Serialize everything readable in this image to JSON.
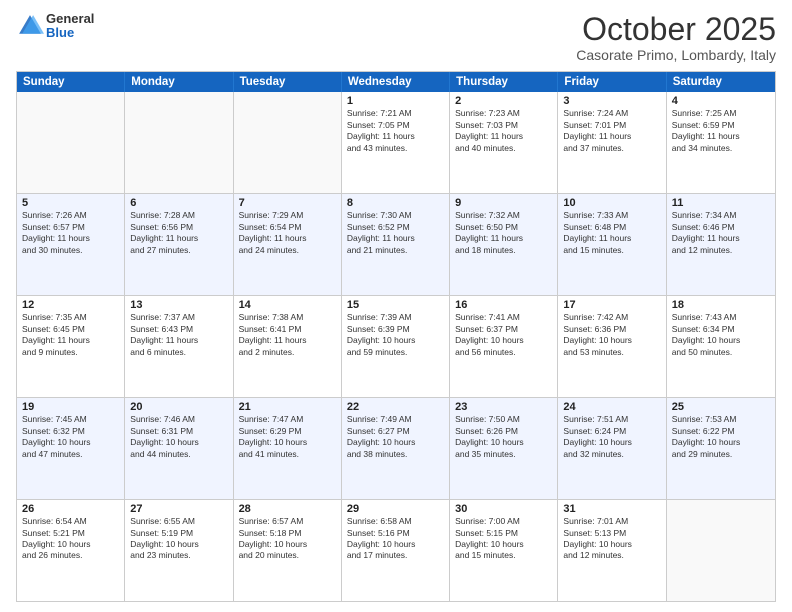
{
  "logo": {
    "general": "General",
    "blue": "Blue"
  },
  "title": "October 2025",
  "subtitle": "Casorate Primo, Lombardy, Italy",
  "header_days": [
    "Sunday",
    "Monday",
    "Tuesday",
    "Wednesday",
    "Thursday",
    "Friday",
    "Saturday"
  ],
  "weeks": [
    [
      {
        "day": "",
        "empty": true,
        "lines": []
      },
      {
        "day": "",
        "empty": true,
        "lines": []
      },
      {
        "day": "",
        "empty": true,
        "lines": []
      },
      {
        "day": "1",
        "lines": [
          "Sunrise: 7:21 AM",
          "Sunset: 7:05 PM",
          "Daylight: 11 hours",
          "and 43 minutes."
        ]
      },
      {
        "day": "2",
        "lines": [
          "Sunrise: 7:23 AM",
          "Sunset: 7:03 PM",
          "Daylight: 11 hours",
          "and 40 minutes."
        ]
      },
      {
        "day": "3",
        "lines": [
          "Sunrise: 7:24 AM",
          "Sunset: 7:01 PM",
          "Daylight: 11 hours",
          "and 37 minutes."
        ]
      },
      {
        "day": "4",
        "lines": [
          "Sunrise: 7:25 AM",
          "Sunset: 6:59 PM",
          "Daylight: 11 hours",
          "and 34 minutes."
        ]
      }
    ],
    [
      {
        "day": "5",
        "lines": [
          "Sunrise: 7:26 AM",
          "Sunset: 6:57 PM",
          "Daylight: 11 hours",
          "and 30 minutes."
        ]
      },
      {
        "day": "6",
        "lines": [
          "Sunrise: 7:28 AM",
          "Sunset: 6:56 PM",
          "Daylight: 11 hours",
          "and 27 minutes."
        ]
      },
      {
        "day": "7",
        "lines": [
          "Sunrise: 7:29 AM",
          "Sunset: 6:54 PM",
          "Daylight: 11 hours",
          "and 24 minutes."
        ]
      },
      {
        "day": "8",
        "lines": [
          "Sunrise: 7:30 AM",
          "Sunset: 6:52 PM",
          "Daylight: 11 hours",
          "and 21 minutes."
        ]
      },
      {
        "day": "9",
        "lines": [
          "Sunrise: 7:32 AM",
          "Sunset: 6:50 PM",
          "Daylight: 11 hours",
          "and 18 minutes."
        ]
      },
      {
        "day": "10",
        "lines": [
          "Sunrise: 7:33 AM",
          "Sunset: 6:48 PM",
          "Daylight: 11 hours",
          "and 15 minutes."
        ]
      },
      {
        "day": "11",
        "lines": [
          "Sunrise: 7:34 AM",
          "Sunset: 6:46 PM",
          "Daylight: 11 hours",
          "and 12 minutes."
        ]
      }
    ],
    [
      {
        "day": "12",
        "lines": [
          "Sunrise: 7:35 AM",
          "Sunset: 6:45 PM",
          "Daylight: 11 hours",
          "and 9 minutes."
        ]
      },
      {
        "day": "13",
        "lines": [
          "Sunrise: 7:37 AM",
          "Sunset: 6:43 PM",
          "Daylight: 11 hours",
          "and 6 minutes."
        ]
      },
      {
        "day": "14",
        "lines": [
          "Sunrise: 7:38 AM",
          "Sunset: 6:41 PM",
          "Daylight: 11 hours",
          "and 2 minutes."
        ]
      },
      {
        "day": "15",
        "lines": [
          "Sunrise: 7:39 AM",
          "Sunset: 6:39 PM",
          "Daylight: 10 hours",
          "and 59 minutes."
        ]
      },
      {
        "day": "16",
        "lines": [
          "Sunrise: 7:41 AM",
          "Sunset: 6:37 PM",
          "Daylight: 10 hours",
          "and 56 minutes."
        ]
      },
      {
        "day": "17",
        "lines": [
          "Sunrise: 7:42 AM",
          "Sunset: 6:36 PM",
          "Daylight: 10 hours",
          "and 53 minutes."
        ]
      },
      {
        "day": "18",
        "lines": [
          "Sunrise: 7:43 AM",
          "Sunset: 6:34 PM",
          "Daylight: 10 hours",
          "and 50 minutes."
        ]
      }
    ],
    [
      {
        "day": "19",
        "lines": [
          "Sunrise: 7:45 AM",
          "Sunset: 6:32 PM",
          "Daylight: 10 hours",
          "and 47 minutes."
        ]
      },
      {
        "day": "20",
        "lines": [
          "Sunrise: 7:46 AM",
          "Sunset: 6:31 PM",
          "Daylight: 10 hours",
          "and 44 minutes."
        ]
      },
      {
        "day": "21",
        "lines": [
          "Sunrise: 7:47 AM",
          "Sunset: 6:29 PM",
          "Daylight: 10 hours",
          "and 41 minutes."
        ]
      },
      {
        "day": "22",
        "lines": [
          "Sunrise: 7:49 AM",
          "Sunset: 6:27 PM",
          "Daylight: 10 hours",
          "and 38 minutes."
        ]
      },
      {
        "day": "23",
        "lines": [
          "Sunrise: 7:50 AM",
          "Sunset: 6:26 PM",
          "Daylight: 10 hours",
          "and 35 minutes."
        ]
      },
      {
        "day": "24",
        "lines": [
          "Sunrise: 7:51 AM",
          "Sunset: 6:24 PM",
          "Daylight: 10 hours",
          "and 32 minutes."
        ]
      },
      {
        "day": "25",
        "lines": [
          "Sunrise: 7:53 AM",
          "Sunset: 6:22 PM",
          "Daylight: 10 hours",
          "and 29 minutes."
        ]
      }
    ],
    [
      {
        "day": "26",
        "lines": [
          "Sunrise: 6:54 AM",
          "Sunset: 5:21 PM",
          "Daylight: 10 hours",
          "and 26 minutes."
        ]
      },
      {
        "day": "27",
        "lines": [
          "Sunrise: 6:55 AM",
          "Sunset: 5:19 PM",
          "Daylight: 10 hours",
          "and 23 minutes."
        ]
      },
      {
        "day": "28",
        "lines": [
          "Sunrise: 6:57 AM",
          "Sunset: 5:18 PM",
          "Daylight: 10 hours",
          "and 20 minutes."
        ]
      },
      {
        "day": "29",
        "lines": [
          "Sunrise: 6:58 AM",
          "Sunset: 5:16 PM",
          "Daylight: 10 hours",
          "and 17 minutes."
        ]
      },
      {
        "day": "30",
        "lines": [
          "Sunrise: 7:00 AM",
          "Sunset: 5:15 PM",
          "Daylight: 10 hours",
          "and 15 minutes."
        ]
      },
      {
        "day": "31",
        "lines": [
          "Sunrise: 7:01 AM",
          "Sunset: 5:13 PM",
          "Daylight: 10 hours",
          "and 12 minutes."
        ]
      },
      {
        "day": "",
        "empty": true,
        "lines": []
      }
    ]
  ]
}
